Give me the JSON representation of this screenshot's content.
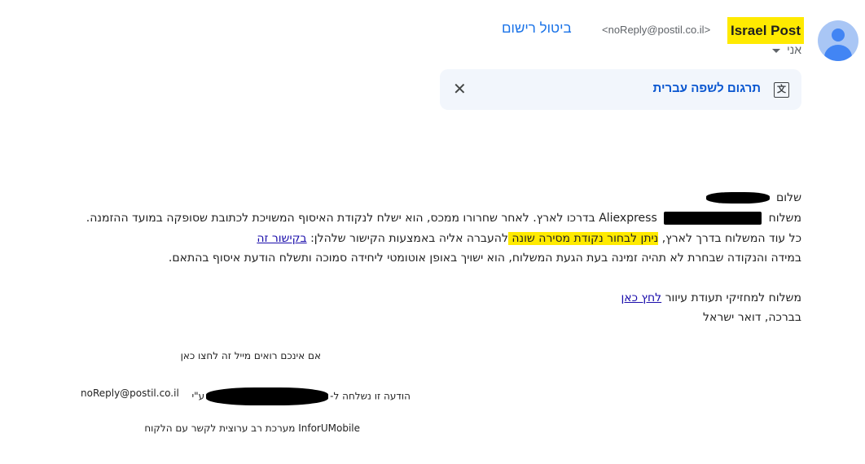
{
  "header": {
    "sender_name": "Israel Post",
    "sender_email": "<noReply@postil.co.il>",
    "unsubscribe_label": "ביטול רישום",
    "to_label": "אני"
  },
  "translate_bar": {
    "label": "תרגום לשפה עברית",
    "close_symbol": "✕",
    "icon_text": "文"
  },
  "body": {
    "greeting": "שלום",
    "line1": "משלוח מ Aliexpress בדרכו לארץ, לאחר שחרורו ממכס, הוא ישלח לנקודת האיסוף המשויכת לכתובת שסופקה במועד ההזמנה.",
    "line1_start": "משלוח",
    "line1_mid": "Aliexpress בדרכו לארץ. לאחר שחרורו ממכס, הוא ישלח לנקודת האיסוף המשויכת לכתובת שסופקה במועד ההזמנה.",
    "line2_before": "כל עוד המשלוח בדרך לארץ, ",
    "line2_highlight": "ניתן לבחור נקודת מסירה שונה ",
    "line2_after": "להעברה אליה באמצעות הקישור שלהלן: ",
    "line2_link": "בקישור זה",
    "line3": "במידה והנקודה שבחרת לא תהיה זמינה בעת הגעת המשלוח, הוא ישויך באופן אוטומטי ליחידה סמוכה ותשלח הודעת איסוף בהתאם.",
    "line4_text": "משלוח למחזיקי תעודת עיוור ",
    "line4_link": "לחץ כאן",
    "signoff": "בברכה, דואר ישראל"
  },
  "footer": {
    "view_issue": "אם אינכם רואים מייל זה לחצו כאן",
    "sent_to": "הודעה זו נשלחה ל-",
    "sent_by": "ע\"י",
    "sender_email": "noReply@postil.co.il",
    "system": "InforUMobile מערכת רב ערוצית לקשר עם הלקוח"
  }
}
